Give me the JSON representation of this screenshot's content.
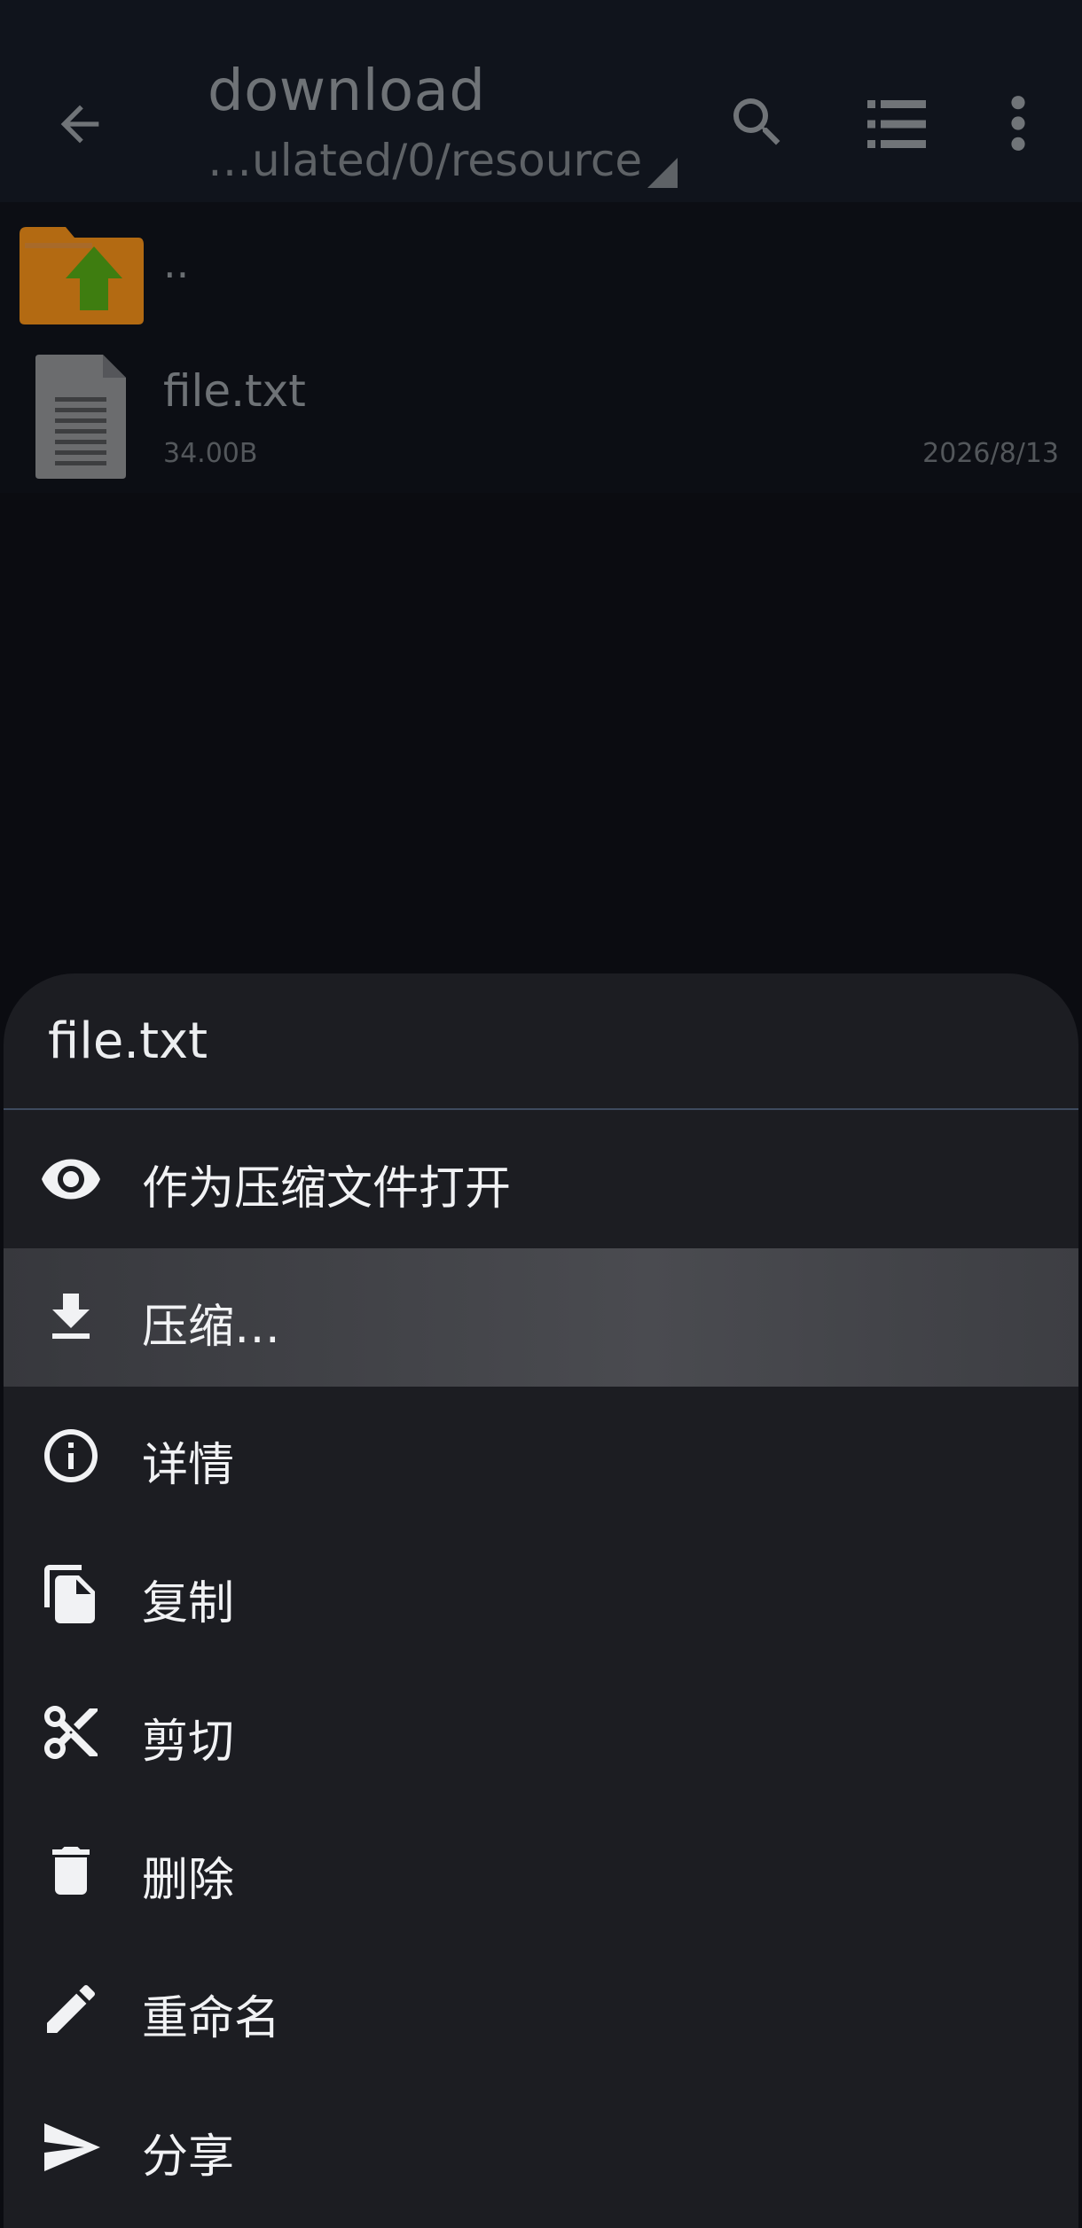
{
  "appbar": {
    "title": "download",
    "path": "…ulated/0/resource"
  },
  "files": {
    "parent_label": "..",
    "items": [
      {
        "name": "file.txt",
        "size": "34.00B",
        "date": "2026/8/13"
      }
    ]
  },
  "sheet": {
    "title": "file.txt",
    "items": [
      {
        "label": "作为压缩文件打开",
        "icon": "eye-icon"
      },
      {
        "label": "压缩…",
        "icon": "download-icon",
        "selected": true
      },
      {
        "label": "详情",
        "icon": "info-icon"
      },
      {
        "label": "复制",
        "icon": "copy-icon"
      },
      {
        "label": "剪切",
        "icon": "scissors-icon"
      },
      {
        "label": "删除",
        "icon": "trash-icon"
      },
      {
        "label": "重命名",
        "icon": "pencil-icon"
      },
      {
        "label": "分享",
        "icon": "send-icon"
      }
    ]
  },
  "colors": {
    "background": "#0b0c11",
    "appbar": "#10141c",
    "sheet": "#1c1d22",
    "selected_row": "#45464b",
    "folder": "#b36a12",
    "folder_arrow": "#3e7d10"
  }
}
